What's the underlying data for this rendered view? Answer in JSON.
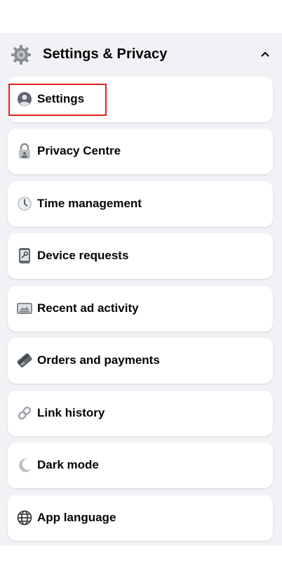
{
  "header": {
    "title": "Settings & Privacy",
    "icon": "gear-icon",
    "chevron": "chevron-up-icon"
  },
  "items": [
    {
      "label": "Settings",
      "icon": "user-circle-icon"
    },
    {
      "label": "Privacy Centre",
      "icon": "padlock-icon"
    },
    {
      "label": "Time management",
      "icon": "clock-icon"
    },
    {
      "label": "Device requests",
      "icon": "phone-key-icon"
    },
    {
      "label": "Recent ad activity",
      "icon": "ad-activity-icon"
    },
    {
      "label": "Orders and payments",
      "icon": "payment-card-icon"
    },
    {
      "label": "Link history",
      "icon": "link-icon"
    },
    {
      "label": "Dark mode",
      "icon": "moon-icon"
    },
    {
      "label": "App language",
      "icon": "globe-icon"
    }
  ],
  "highlight": {
    "color": "#e0201c",
    "target": "Settings"
  }
}
